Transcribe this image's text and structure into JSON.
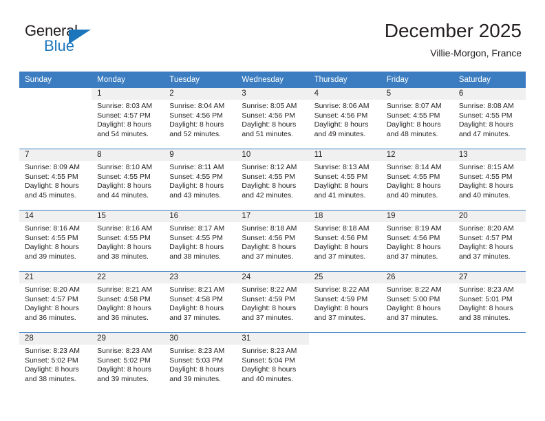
{
  "brand": {
    "word_general": "General",
    "word_blue": "Blue",
    "accent_color": "#1b76bc"
  },
  "header": {
    "title": "December 2025",
    "subtitle": "Villie-Morgon, France"
  },
  "calendar": {
    "header_bg": "#3b7dc0",
    "daynum_band_bg": "#f0f0f0",
    "weekdays": [
      "Sunday",
      "Monday",
      "Tuesday",
      "Wednesday",
      "Thursday",
      "Friday",
      "Saturday"
    ],
    "weeks": [
      [
        {
          "day": "",
          "sunrise": "",
          "sunset": "",
          "daylight1": "",
          "daylight2": ""
        },
        {
          "day": "1",
          "sunrise": "Sunrise: 8:03 AM",
          "sunset": "Sunset: 4:57 PM",
          "daylight1": "Daylight: 8 hours",
          "daylight2": "and 54 minutes."
        },
        {
          "day": "2",
          "sunrise": "Sunrise: 8:04 AM",
          "sunset": "Sunset: 4:56 PM",
          "daylight1": "Daylight: 8 hours",
          "daylight2": "and 52 minutes."
        },
        {
          "day": "3",
          "sunrise": "Sunrise: 8:05 AM",
          "sunset": "Sunset: 4:56 PM",
          "daylight1": "Daylight: 8 hours",
          "daylight2": "and 51 minutes."
        },
        {
          "day": "4",
          "sunrise": "Sunrise: 8:06 AM",
          "sunset": "Sunset: 4:56 PM",
          "daylight1": "Daylight: 8 hours",
          "daylight2": "and 49 minutes."
        },
        {
          "day": "5",
          "sunrise": "Sunrise: 8:07 AM",
          "sunset": "Sunset: 4:55 PM",
          "daylight1": "Daylight: 8 hours",
          "daylight2": "and 48 minutes."
        },
        {
          "day": "6",
          "sunrise": "Sunrise: 8:08 AM",
          "sunset": "Sunset: 4:55 PM",
          "daylight1": "Daylight: 8 hours",
          "daylight2": "and 47 minutes."
        }
      ],
      [
        {
          "day": "7",
          "sunrise": "Sunrise: 8:09 AM",
          "sunset": "Sunset: 4:55 PM",
          "daylight1": "Daylight: 8 hours",
          "daylight2": "and 45 minutes."
        },
        {
          "day": "8",
          "sunrise": "Sunrise: 8:10 AM",
          "sunset": "Sunset: 4:55 PM",
          "daylight1": "Daylight: 8 hours",
          "daylight2": "and 44 minutes."
        },
        {
          "day": "9",
          "sunrise": "Sunrise: 8:11 AM",
          "sunset": "Sunset: 4:55 PM",
          "daylight1": "Daylight: 8 hours",
          "daylight2": "and 43 minutes."
        },
        {
          "day": "10",
          "sunrise": "Sunrise: 8:12 AM",
          "sunset": "Sunset: 4:55 PM",
          "daylight1": "Daylight: 8 hours",
          "daylight2": "and 42 minutes."
        },
        {
          "day": "11",
          "sunrise": "Sunrise: 8:13 AM",
          "sunset": "Sunset: 4:55 PM",
          "daylight1": "Daylight: 8 hours",
          "daylight2": "and 41 minutes."
        },
        {
          "day": "12",
          "sunrise": "Sunrise: 8:14 AM",
          "sunset": "Sunset: 4:55 PM",
          "daylight1": "Daylight: 8 hours",
          "daylight2": "and 40 minutes."
        },
        {
          "day": "13",
          "sunrise": "Sunrise: 8:15 AM",
          "sunset": "Sunset: 4:55 PM",
          "daylight1": "Daylight: 8 hours",
          "daylight2": "and 40 minutes."
        }
      ],
      [
        {
          "day": "14",
          "sunrise": "Sunrise: 8:16 AM",
          "sunset": "Sunset: 4:55 PM",
          "daylight1": "Daylight: 8 hours",
          "daylight2": "and 39 minutes."
        },
        {
          "day": "15",
          "sunrise": "Sunrise: 8:16 AM",
          "sunset": "Sunset: 4:55 PM",
          "daylight1": "Daylight: 8 hours",
          "daylight2": "and 38 minutes."
        },
        {
          "day": "16",
          "sunrise": "Sunrise: 8:17 AM",
          "sunset": "Sunset: 4:55 PM",
          "daylight1": "Daylight: 8 hours",
          "daylight2": "and 38 minutes."
        },
        {
          "day": "17",
          "sunrise": "Sunrise: 8:18 AM",
          "sunset": "Sunset: 4:56 PM",
          "daylight1": "Daylight: 8 hours",
          "daylight2": "and 37 minutes."
        },
        {
          "day": "18",
          "sunrise": "Sunrise: 8:18 AM",
          "sunset": "Sunset: 4:56 PM",
          "daylight1": "Daylight: 8 hours",
          "daylight2": "and 37 minutes."
        },
        {
          "day": "19",
          "sunrise": "Sunrise: 8:19 AM",
          "sunset": "Sunset: 4:56 PM",
          "daylight1": "Daylight: 8 hours",
          "daylight2": "and 37 minutes."
        },
        {
          "day": "20",
          "sunrise": "Sunrise: 8:20 AM",
          "sunset": "Sunset: 4:57 PM",
          "daylight1": "Daylight: 8 hours",
          "daylight2": "and 37 minutes."
        }
      ],
      [
        {
          "day": "21",
          "sunrise": "Sunrise: 8:20 AM",
          "sunset": "Sunset: 4:57 PM",
          "daylight1": "Daylight: 8 hours",
          "daylight2": "and 36 minutes."
        },
        {
          "day": "22",
          "sunrise": "Sunrise: 8:21 AM",
          "sunset": "Sunset: 4:58 PM",
          "daylight1": "Daylight: 8 hours",
          "daylight2": "and 36 minutes."
        },
        {
          "day": "23",
          "sunrise": "Sunrise: 8:21 AM",
          "sunset": "Sunset: 4:58 PM",
          "daylight1": "Daylight: 8 hours",
          "daylight2": "and 37 minutes."
        },
        {
          "day": "24",
          "sunrise": "Sunrise: 8:22 AM",
          "sunset": "Sunset: 4:59 PM",
          "daylight1": "Daylight: 8 hours",
          "daylight2": "and 37 minutes."
        },
        {
          "day": "25",
          "sunrise": "Sunrise: 8:22 AM",
          "sunset": "Sunset: 4:59 PM",
          "daylight1": "Daylight: 8 hours",
          "daylight2": "and 37 minutes."
        },
        {
          "day": "26",
          "sunrise": "Sunrise: 8:22 AM",
          "sunset": "Sunset: 5:00 PM",
          "daylight1": "Daylight: 8 hours",
          "daylight2": "and 37 minutes."
        },
        {
          "day": "27",
          "sunrise": "Sunrise: 8:23 AM",
          "sunset": "Sunset: 5:01 PM",
          "daylight1": "Daylight: 8 hours",
          "daylight2": "and 38 minutes."
        }
      ],
      [
        {
          "day": "28",
          "sunrise": "Sunrise: 8:23 AM",
          "sunset": "Sunset: 5:02 PM",
          "daylight1": "Daylight: 8 hours",
          "daylight2": "and 38 minutes."
        },
        {
          "day": "29",
          "sunrise": "Sunrise: 8:23 AM",
          "sunset": "Sunset: 5:02 PM",
          "daylight1": "Daylight: 8 hours",
          "daylight2": "and 39 minutes."
        },
        {
          "day": "30",
          "sunrise": "Sunrise: 8:23 AM",
          "sunset": "Sunset: 5:03 PM",
          "daylight1": "Daylight: 8 hours",
          "daylight2": "and 39 minutes."
        },
        {
          "day": "31",
          "sunrise": "Sunrise: 8:23 AM",
          "sunset": "Sunset: 5:04 PM",
          "daylight1": "Daylight: 8 hours",
          "daylight2": "and 40 minutes."
        },
        {
          "day": "",
          "sunrise": "",
          "sunset": "",
          "daylight1": "",
          "daylight2": ""
        },
        {
          "day": "",
          "sunrise": "",
          "sunset": "",
          "daylight1": "",
          "daylight2": ""
        },
        {
          "day": "",
          "sunrise": "",
          "sunset": "",
          "daylight1": "",
          "daylight2": ""
        }
      ]
    ]
  }
}
